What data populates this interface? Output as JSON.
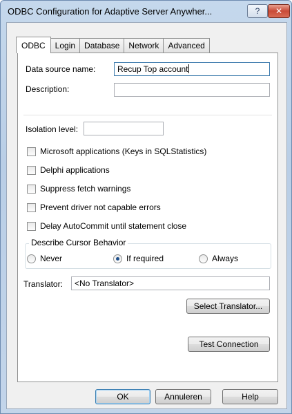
{
  "window": {
    "title": "ODBC Configuration for Adaptive Server Anywher...",
    "help_glyph": "?",
    "close_glyph": "✕"
  },
  "tabs": [
    {
      "label": "ODBC",
      "active": true
    },
    {
      "label": "Login",
      "active": false
    },
    {
      "label": "Database",
      "active": false
    },
    {
      "label": "Network",
      "active": false
    },
    {
      "label": "Advanced",
      "active": false
    }
  ],
  "odbc": {
    "data_source_name_label": "Data source name:",
    "data_source_name_value": "Recup Top account",
    "description_label": "Description:",
    "description_value": "",
    "isolation_level_label": "Isolation level:",
    "isolation_level_value": "",
    "checkboxes": [
      {
        "label": "Microsoft applications (Keys in SQLStatistics)",
        "checked": false
      },
      {
        "label": "Delphi applications",
        "checked": false
      },
      {
        "label": "Suppress fetch warnings",
        "checked": false
      },
      {
        "label": "Prevent driver not capable errors",
        "checked": false
      },
      {
        "label": "Delay AutoCommit until statement close",
        "checked": false
      }
    ],
    "cursor_group": {
      "label": "Describe Cursor Behavior",
      "options": [
        {
          "label": "Never",
          "selected": false
        },
        {
          "label": "If required",
          "selected": true
        },
        {
          "label": "Always",
          "selected": false
        }
      ]
    },
    "translator_label": "Translator:",
    "translator_value": "<No Translator>",
    "select_translator_button": "Select Translator...",
    "test_connection_button": "Test Connection"
  },
  "footer": {
    "ok_button": "OK",
    "cancel_button": "Annuleren",
    "help_button": "Help"
  }
}
